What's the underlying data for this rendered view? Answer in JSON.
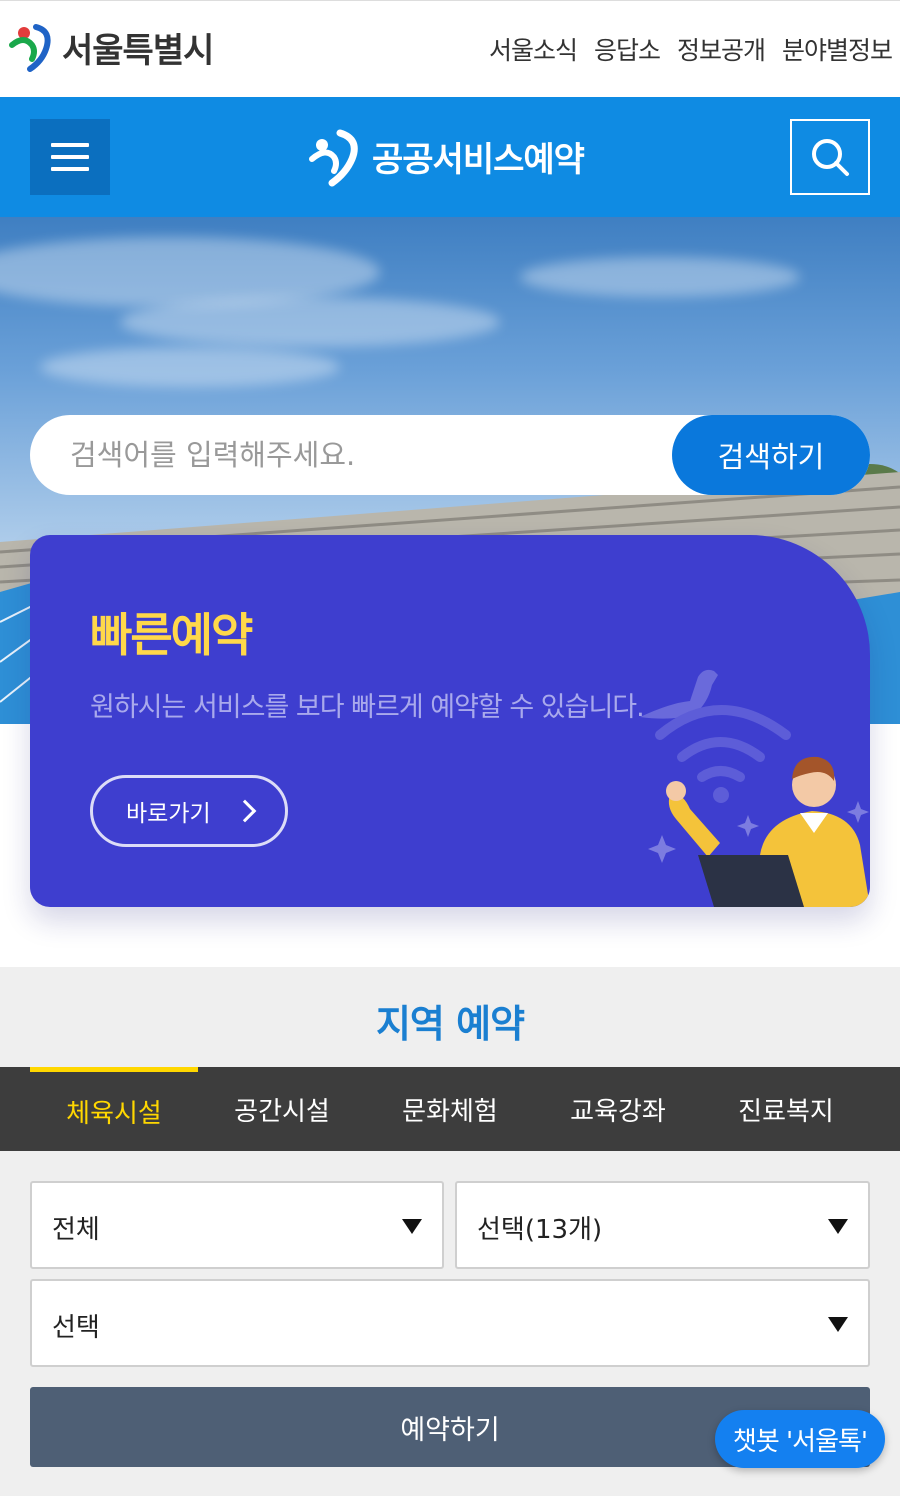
{
  "topbar": {
    "logo_text": "서울특별시",
    "nav": [
      "서울소식",
      "응답소",
      "정보공개",
      "분야별정보"
    ]
  },
  "header": {
    "brand_text": "공공서비스예약"
  },
  "search": {
    "placeholder": "검색어를 입력해주세요.",
    "button_label": "검색하기"
  },
  "quick": {
    "title": "빠른예약",
    "description": "원하시는 서비스를 보다 빠르게 예약할 수 있습니다.",
    "link_label": "바로가기"
  },
  "region": {
    "title": "지역 예약",
    "tabs": [
      "체육시설",
      "공간시설",
      "문화체험",
      "교육강좌",
      "진료복지"
    ],
    "active_tab": "체육시설",
    "select_area": "전체",
    "select_category": "선택(13개)",
    "select_facility": "선택",
    "reserve_label": "예약하기"
  },
  "chatbot": {
    "label": "챗봇 '서울톡'"
  },
  "colors": {
    "header_blue": "#0f8be3",
    "card_purple": "#3e3ecf",
    "accent_yellow": "#ffd84a",
    "title_blue": "#1a7fd1",
    "tab_dark": "#3d3d3d",
    "button_slate": "#4e5f75"
  },
  "icons": [
    "seoul-logo-icon",
    "menu-icon",
    "search-icon",
    "chevron-right-icon",
    "dropdown-arrow-icon",
    "bird-wifi-illustration"
  ]
}
